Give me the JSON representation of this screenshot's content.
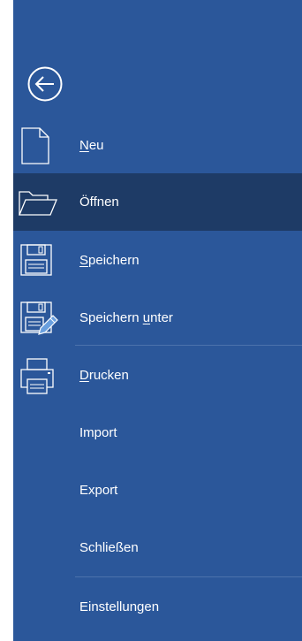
{
  "menu": {
    "items": [
      {
        "id": "new",
        "pre": "",
        "mnemonic": "N",
        "post": "eu",
        "icon": "new-document-icon"
      },
      {
        "id": "open",
        "pre": "Öffnen",
        "mnemonic": "",
        "post": "",
        "icon": "folder-open-icon",
        "selected": true
      },
      {
        "id": "save",
        "pre": "",
        "mnemonic": "S",
        "post": "peichern",
        "icon": "save-icon"
      },
      {
        "id": "save-as",
        "pre": "Speichern ",
        "mnemonic": "u",
        "post": "nter",
        "icon": "save-as-icon"
      },
      {
        "id": "print",
        "pre": "",
        "mnemonic": "D",
        "post": "rucken",
        "icon": "printer-icon"
      },
      {
        "id": "import",
        "pre": "Import",
        "mnemonic": "",
        "post": ""
      },
      {
        "id": "export",
        "pre": "Export",
        "mnemonic": "",
        "post": ""
      },
      {
        "id": "close",
        "pre": "Schließen",
        "mnemonic": "",
        "post": ""
      },
      {
        "id": "settings",
        "pre": "Einstellungen",
        "mnemonic": "",
        "post": ""
      }
    ]
  },
  "colors": {
    "background": "#2b579a",
    "selected": "#1e3b66",
    "divider": "#4c72ac",
    "text": "#ffffff"
  }
}
